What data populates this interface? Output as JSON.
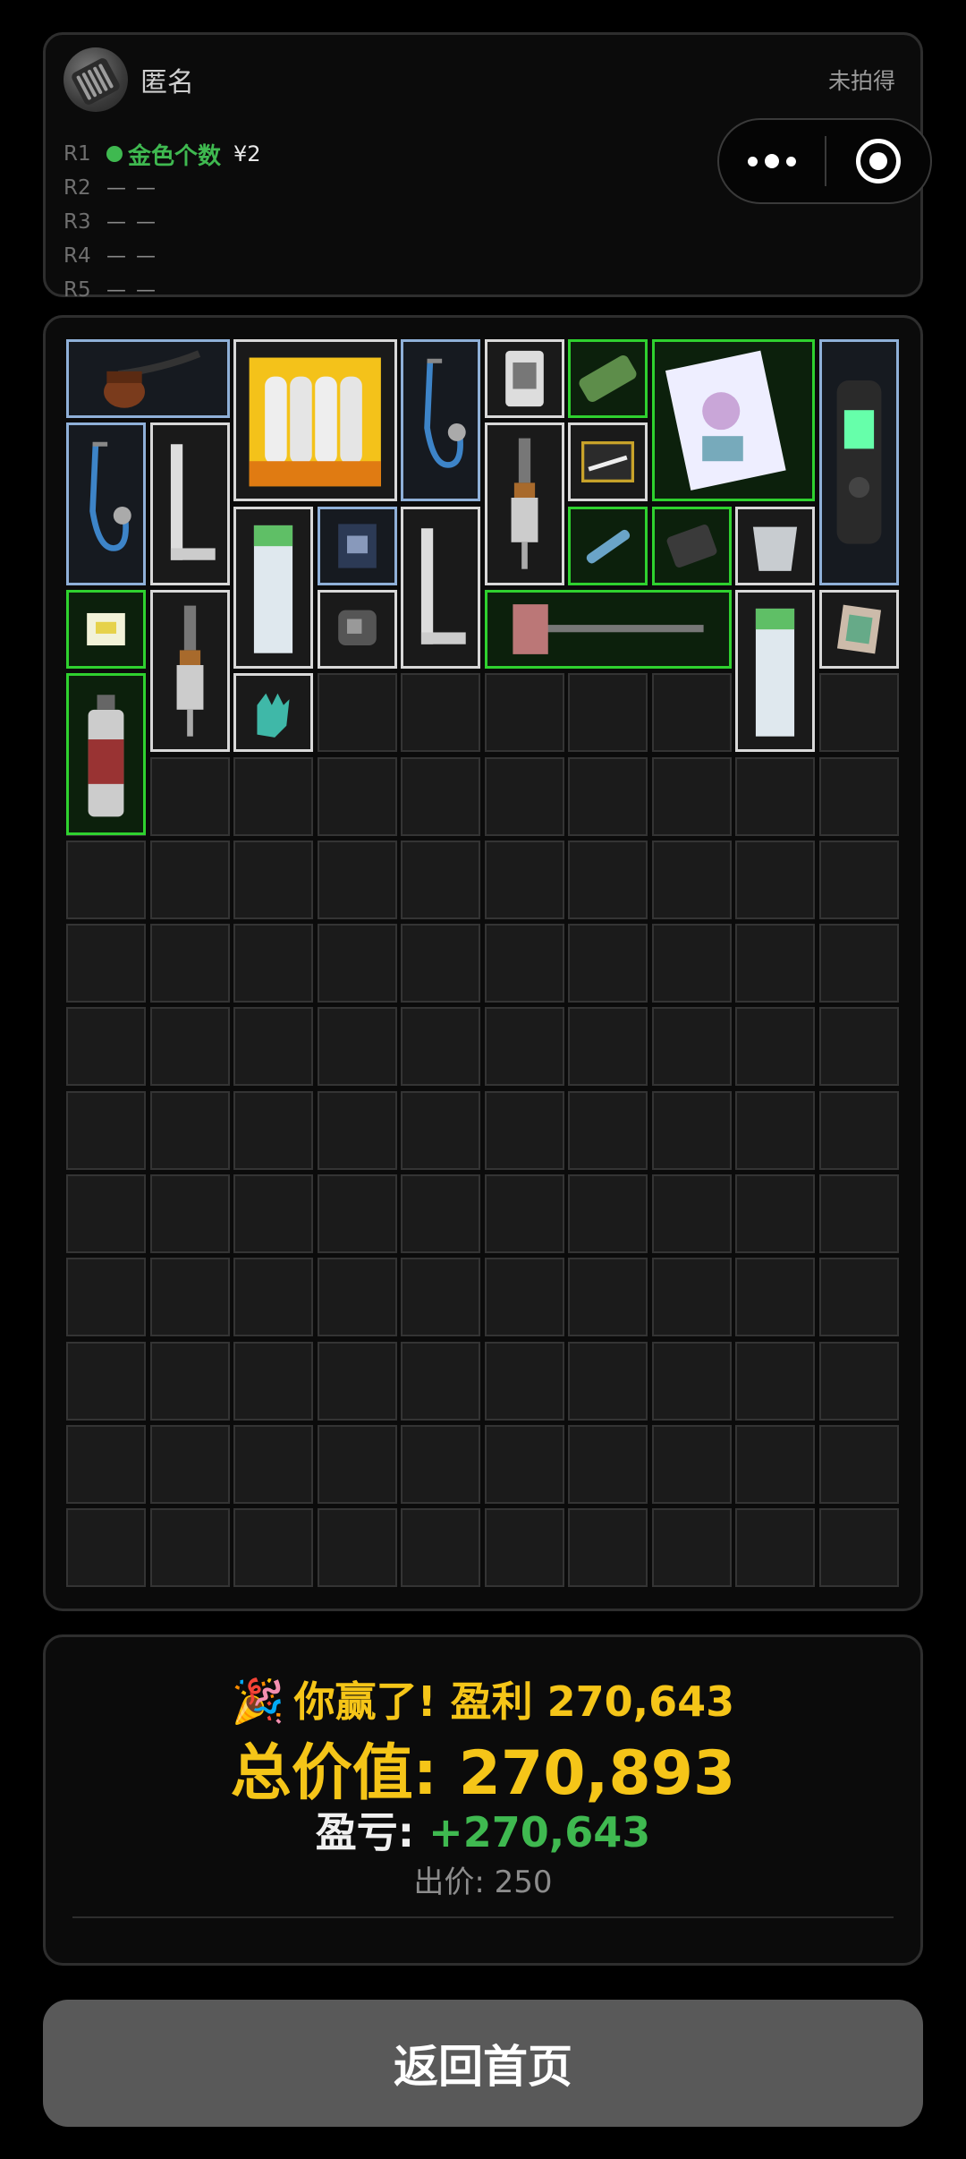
{
  "header": {
    "avatar_icon": "screwdriver-set-icon",
    "user_name": "匿名",
    "status": "未拍得",
    "rounds": [
      {
        "label": "R1",
        "result": "金色个数",
        "price": "¥2",
        "active": true
      },
      {
        "label": "R2",
        "result": "— —",
        "active": false
      },
      {
        "label": "R3",
        "result": "— —",
        "active": false
      },
      {
        "label": "R4",
        "result": "— —",
        "active": false
      },
      {
        "label": "R5",
        "result": "— —",
        "active": false
      }
    ],
    "capsule": {
      "more_icon": "more-dots-icon",
      "close_icon": "target-close-icon"
    }
  },
  "inventory": {
    "columns": 10,
    "rows": 15,
    "colors": {
      "white": "#d8d8d8",
      "blue": "#8fb0d8",
      "green": "#2fd12f"
    },
    "items": [
      {
        "name": "tobacco-pipe",
        "icon": "pipe-icon",
        "rarity": "blue",
        "col": 0,
        "row": 0,
        "w": 2,
        "h": 1
      },
      {
        "name": "replace-candle-box",
        "icon": "candle-box-icon",
        "rarity": "white",
        "col": 2,
        "row": 0,
        "w": 2,
        "h": 2
      },
      {
        "name": "stethoscope",
        "icon": "stethoscope-icon",
        "rarity": "blue",
        "col": 4,
        "row": 0,
        "w": 1,
        "h": 2
      },
      {
        "name": "playing-card",
        "icon": "card-icon",
        "rarity": "white",
        "col": 5,
        "row": 0,
        "w": 1,
        "h": 1
      },
      {
        "name": "snack-bar",
        "icon": "snack-icon",
        "rarity": "green",
        "col": 6,
        "row": 0,
        "w": 1,
        "h": 1
      },
      {
        "name": "fashion-magazine",
        "icon": "magazine-icon",
        "rarity": "green",
        "col": 7,
        "row": 0,
        "w": 2,
        "h": 2
      },
      {
        "name": "voice-recorder",
        "icon": "recorder-icon",
        "rarity": "blue",
        "col": 9,
        "row": 0,
        "w": 1,
        "h": 3
      },
      {
        "name": "stethoscope",
        "icon": "stethoscope-icon",
        "rarity": "blue",
        "col": 0,
        "row": 1,
        "w": 1,
        "h": 2
      },
      {
        "name": "carpenter-square",
        "icon": "square-ruler-icon",
        "rarity": "white",
        "col": 1,
        "row": 1,
        "w": 1,
        "h": 2
      },
      {
        "name": "pipette-tool",
        "icon": "pipette-icon",
        "rarity": "white",
        "col": 5,
        "row": 1,
        "w": 1,
        "h": 2
      },
      {
        "name": "cotton-swab-box",
        "icon": "swab-box-icon",
        "rarity": "white",
        "col": 6,
        "row": 1,
        "w": 1,
        "h": 1
      },
      {
        "name": "toothpaste",
        "icon": "toothpaste-icon",
        "rarity": "white",
        "col": 2,
        "row": 2,
        "w": 1,
        "h": 2
      },
      {
        "name": "circuit-module",
        "icon": "chip-icon",
        "rarity": "blue",
        "col": 3,
        "row": 2,
        "w": 1,
        "h": 1
      },
      {
        "name": "carpenter-square",
        "icon": "square-ruler-icon",
        "rarity": "white",
        "col": 4,
        "row": 2,
        "w": 1,
        "h": 2
      },
      {
        "name": "test-pen",
        "icon": "pen-icon",
        "rarity": "green",
        "col": 6,
        "row": 2,
        "w": 1,
        "h": 1
      },
      {
        "name": "battery-pack",
        "icon": "battery-icon",
        "rarity": "green",
        "col": 7,
        "row": 2,
        "w": 1,
        "h": 1
      },
      {
        "name": "yogurt-cup",
        "icon": "cup-icon",
        "rarity": "white",
        "col": 8,
        "row": 2,
        "w": 1,
        "h": 1
      },
      {
        "name": "notebook-chip",
        "icon": "label-icon",
        "rarity": "green",
        "col": 0,
        "row": 3,
        "w": 1,
        "h": 1
      },
      {
        "name": "pipette-tool",
        "icon": "pipette-icon",
        "rarity": "white",
        "col": 1,
        "row": 3,
        "w": 1,
        "h": 2
      },
      {
        "name": "tape-measure",
        "icon": "tape-measure-icon",
        "rarity": "white",
        "col": 3,
        "row": 3,
        "w": 1,
        "h": 1
      },
      {
        "name": "sledge-hammer",
        "icon": "hammer-icon",
        "rarity": "green",
        "col": 5,
        "row": 3,
        "w": 3,
        "h": 1
      },
      {
        "name": "toothpaste",
        "icon": "toothpaste-icon",
        "rarity": "white",
        "col": 8,
        "row": 3,
        "w": 1,
        "h": 2
      },
      {
        "name": "matchbox",
        "icon": "matchbox-icon",
        "rarity": "white",
        "col": 9,
        "row": 3,
        "w": 1,
        "h": 1
      },
      {
        "name": "spray-can",
        "icon": "spray-can-icon",
        "rarity": "green",
        "col": 0,
        "row": 4,
        "w": 1,
        "h": 2
      },
      {
        "name": "work-glove",
        "icon": "glove-icon",
        "rarity": "white",
        "col": 2,
        "row": 4,
        "w": 1,
        "h": 1
      }
    ]
  },
  "result": {
    "party_icon": "party-popper-icon",
    "win_text": "你赢了! 盈利 270,643",
    "total_label": "总价值:",
    "total_value": "270,893",
    "pnl_label": "盈亏:",
    "pnl_value": "+270,643",
    "bid_text": "出价: 250"
  },
  "home_button": {
    "label": "返回首页"
  }
}
